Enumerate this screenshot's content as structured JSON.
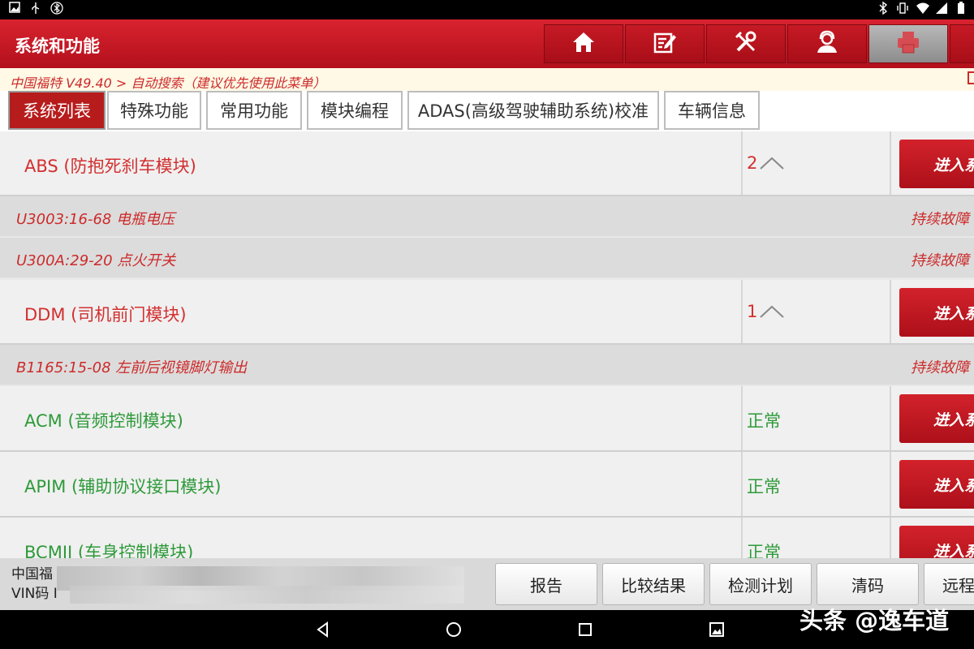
{
  "header": {
    "title": "系统和功能"
  },
  "header_buttons": [
    {
      "icon": "home-icon"
    },
    {
      "icon": "edit-icon"
    },
    {
      "icon": "tools-icon"
    },
    {
      "icon": "support-agent-icon"
    },
    {
      "icon": "printer-icon"
    }
  ],
  "breadcrumb": {
    "text": "中国福特 V49.40 > 自动搜索（建议优先使用此菜单）"
  },
  "tabs": [
    {
      "label": "系统列表",
      "active": true
    },
    {
      "label": "特殊功能"
    },
    {
      "label": "常用功能"
    },
    {
      "label": "模块编程"
    },
    {
      "label": "ADAS(高级驾驶辅助系统)校准"
    },
    {
      "label": "车辆信息"
    }
  ],
  "modules": [
    {
      "name": "ABS (防抱死刹车模块)",
      "status": "2",
      "enter": "进入系",
      "color": "#d32f2f"
    },
    {
      "name": "DDM (司机前门模块)",
      "status": "1",
      "enter": "进入系",
      "color": "#d32f2f"
    },
    {
      "name": "ACM (音频控制模块)",
      "status": "正常",
      "enter": "进入系",
      "color": "#2e9a3a"
    },
    {
      "name": "APIM (辅助协议接口模块)",
      "status": "正常",
      "enter": "进入系",
      "color": "#2e9a3a"
    },
    {
      "name": "BCMII (车身控制模块)",
      "status": "正常",
      "enter": "进入系",
      "color": "#2e9a3a"
    }
  ],
  "faults": [
    {
      "code": "U3003:16-68 电瓶电压",
      "status": "持续故障"
    },
    {
      "code": "U300A:29-20 点火开关",
      "status": "持续故障"
    },
    {
      "code": "B1165:15-08 左前后视镜脚灯输出",
      "status": "持续故障"
    }
  ],
  "vehicle": {
    "line1": "中国福",
    "line2": "VIN码 I"
  },
  "bottom_buttons": [
    "报告",
    "比较结果",
    "检测计划",
    "清码",
    "远程"
  ],
  "watermark": "头条 @逸车道",
  "colors": {
    "brand_red": "#c8161f",
    "fault_red": "#cc2a2a",
    "normal_green": "#2e9a3a"
  }
}
